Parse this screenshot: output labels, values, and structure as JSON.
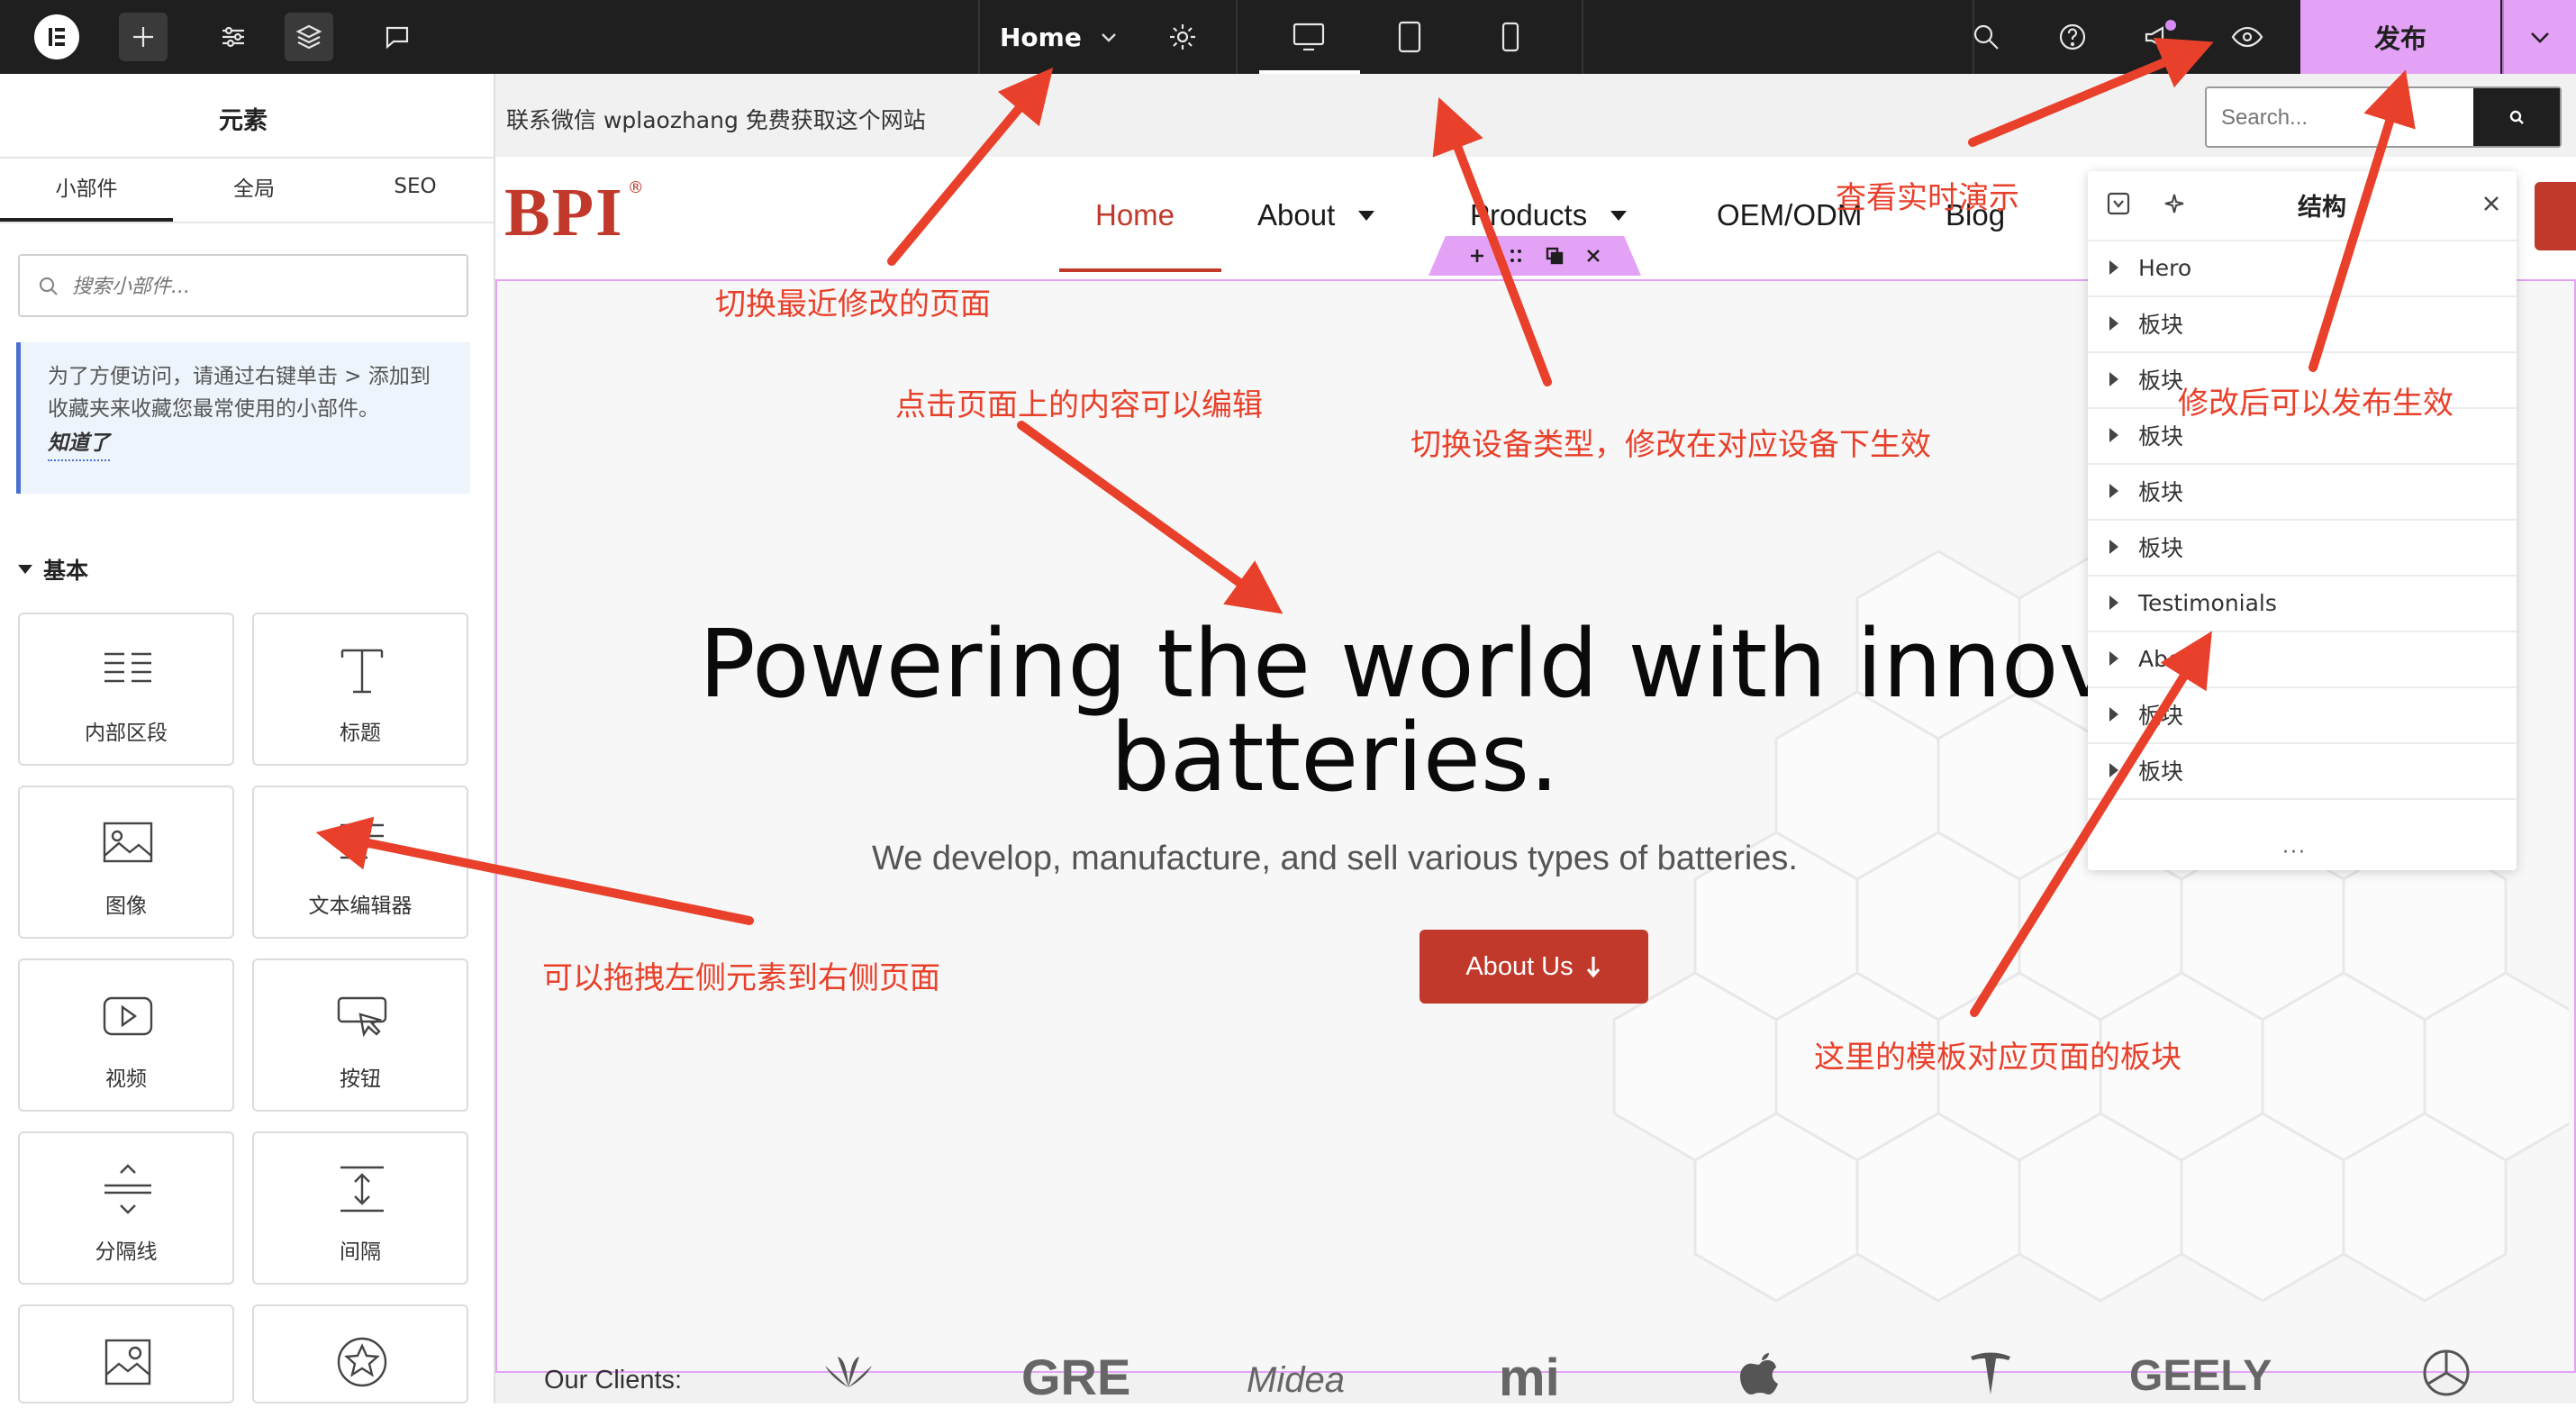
{
  "topbar": {
    "page_name": "Home",
    "publish_label": "发布",
    "colors": {
      "bg": "#1f1f1f",
      "publish": "#e4a2f7"
    }
  },
  "left_panel": {
    "title": "元素",
    "tabs": [
      "小部件",
      "全局",
      "SEO"
    ],
    "search_placeholder": "搜索小部件...",
    "info_text_line1": "为了方便访问，请通过右键单击 > 添加到",
    "info_text_line2": "收藏夹来收藏您最常使用的小部件。",
    "info_dismiss": "知道了",
    "section_title": "基本",
    "widgets": [
      {
        "label": "内部区段",
        "icon": "inner-section-icon"
      },
      {
        "label": "标题",
        "icon": "heading-icon"
      },
      {
        "label": "图像",
        "icon": "image-icon"
      },
      {
        "label": "文本编辑器",
        "icon": "text-editor-icon"
      },
      {
        "label": "视频",
        "icon": "video-icon"
      },
      {
        "label": "按钮",
        "icon": "button-icon"
      },
      {
        "label": "分隔线",
        "icon": "divider-icon"
      },
      {
        "label": "间隔",
        "icon": "spacer-icon"
      },
      {
        "label": "",
        "icon": "image-box-icon"
      },
      {
        "label": "",
        "icon": "star-icon"
      }
    ]
  },
  "canvas": {
    "topline": "联系微信 wplaozhang 免费获取这个网站",
    "search_placeholder": "Search...",
    "site_logo": "BPI",
    "nav": [
      "Home",
      "About",
      "Products",
      "OEM/ODM",
      "Blog"
    ],
    "hero_title_line1": "Powering the world with innov",
    "hero_title_line2": "batteries.",
    "hero_sub": "We develop, manufacture, and sell various types of batteries.",
    "hero_button": "About Us",
    "clients_label": "Our Clients:",
    "client_logos": [
      "GRE",
      "Midea",
      "mi",
      "GEELY"
    ],
    "accent": "#c0392b"
  },
  "structure": {
    "title": "结构",
    "items": [
      "Hero",
      "板块",
      "板块",
      "板块",
      "板块",
      "板块",
      "Testimonials",
      "Abo",
      "板块",
      "板块"
    ]
  },
  "annotations": {
    "recent_pages": "切换最近修改的页面",
    "click_edit": "点击页面上的内容可以编辑",
    "switch_device": "切换设备类型，修改在对应设备下生效",
    "preview": "查看实时演示",
    "publish": "修改后可以发布生效",
    "drag": "可以拖拽左侧元素到右侧页面",
    "template": "这里的模板对应页面的板块"
  }
}
